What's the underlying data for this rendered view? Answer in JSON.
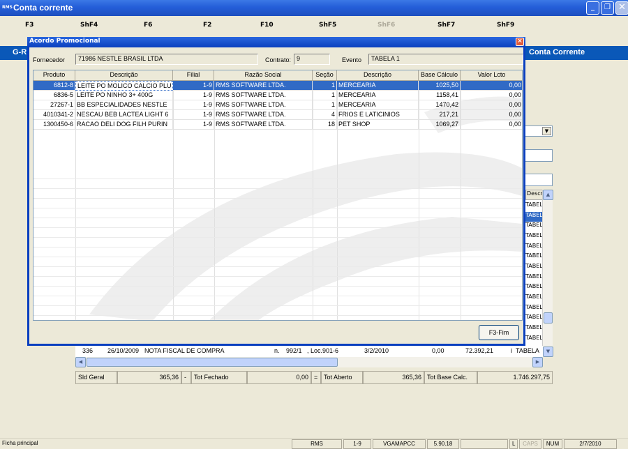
{
  "window": {
    "title": "Conta corrente",
    "app_icon_text": "RMS"
  },
  "fkeys": [
    {
      "key": "F3",
      "disabled": false
    },
    {
      "key": "ShF4",
      "disabled": false
    },
    {
      "key": "F6",
      "disabled": false
    },
    {
      "key": "F2",
      "disabled": false
    },
    {
      "key": "F10",
      "disabled": false
    },
    {
      "key": "ShF5",
      "disabled": false
    },
    {
      "key": "ShF6",
      "disabled": true
    },
    {
      "key": "ShF7",
      "disabled": false
    },
    {
      "key": "ShF9",
      "disabled": false
    }
  ],
  "background": {
    "header_left": "G-R",
    "header_right": "Conta Corrente",
    "right_col_header": "Descriç",
    "right_col_values": [
      "TABELA",
      "TABELA",
      "TABELA",
      "TABELA",
      "TABELA",
      "TABELA",
      "TABELA",
      "TABELA",
      "TABELA",
      "TABELA",
      "TABELA",
      "TABELA",
      "TABELA",
      "TABELA",
      "TABELA"
    ],
    "last_row": {
      "num": "336",
      "date": "26/10/2009",
      "desc": "NOTA FISCAL DE COMPRA",
      "n": "n.",
      "doc": "992/1",
      "loc": ", Loc.901-6",
      "date2": "3/2/2010",
      "v1": "0,00",
      "v2": "72.392,21",
      "tipo": "i",
      "tab": "TABELA"
    },
    "totals": {
      "sld_label": "Sld Geral",
      "sld_value": "365,36",
      "minus": "-",
      "fechado_label": "Tot Fechado",
      "fechado_value": "0,00",
      "equals": "=",
      "aberto_label": "Tot Aberto",
      "aberto_value": "365,36",
      "base_label": "Tot Base Calc.",
      "base_value": "1.746.297,75"
    }
  },
  "dialog": {
    "title": "Acordo Promocional",
    "fornecedor_label": "Fornecedor",
    "fornecedor_value": "71986 NESTLE BRASIL LTDA",
    "contrato_label": "Contrato:",
    "contrato_value": "9",
    "evento_label": "Evento",
    "evento_value": "TABELA 1",
    "columns": [
      "Produto",
      "Descrição",
      "Filial",
      "Razão Social",
      "Seção",
      "Descrição",
      "Base Cálculo",
      "Valor Lcto"
    ],
    "rows": [
      {
        "produto": "6812-8",
        "descricao": "LEITE PO MOLICO CALCIO PLU",
        "filial": "1-9",
        "razao": "RMS SOFTWARE LTDA.",
        "secao": "1",
        "secao_desc": "MERCEARIA",
        "base": "1025,50",
        "valor": "0,00",
        "selected": true
      },
      {
        "produto": "6836-5",
        "descricao": "LEITE PO NINHO 3+ 400G",
        "filial": "1-9",
        "razao": "RMS SOFTWARE LTDA.",
        "secao": "1",
        "secao_desc": "MERCEARIA",
        "base": "1158,41",
        "valor": "0,00",
        "selected": false
      },
      {
        "produto": "27267-1",
        "descricao": "BB ESPECIALIDADES NESTLE",
        "filial": "1-9",
        "razao": "RMS SOFTWARE LTDA.",
        "secao": "1",
        "secao_desc": "MERCEARIA",
        "base": "1470,42",
        "valor": "0,00",
        "selected": false
      },
      {
        "produto": "4010341-2",
        "descricao": "NESCAU BEB LACTEA LIGHT 6",
        "filial": "1-9",
        "razao": "RMS SOFTWARE LTDA.",
        "secao": "4",
        "secao_desc": "FRIOS E LATICINIOS",
        "base": "217,21",
        "valor": "0,00",
        "selected": false
      },
      {
        "produto": "1300450-6",
        "descricao": "RACAO DELI DOG FILH PURIN",
        "filial": "1-9",
        "razao": "RMS SOFTWARE LTDA.",
        "secao": "18",
        "secao_desc": "PET SHOP",
        "base": "1069,27",
        "valor": "0,00",
        "selected": false
      }
    ],
    "close_button": "F3-Fim"
  },
  "statusbar": {
    "left": "Ficha principal",
    "app": "RMS",
    "filial": "1-9",
    "host": "VGAMAPCC",
    "version": "5.90.18",
    "l": "L",
    "caps": "CAPS",
    "num": "NUM",
    "date": "2/7/2010"
  }
}
